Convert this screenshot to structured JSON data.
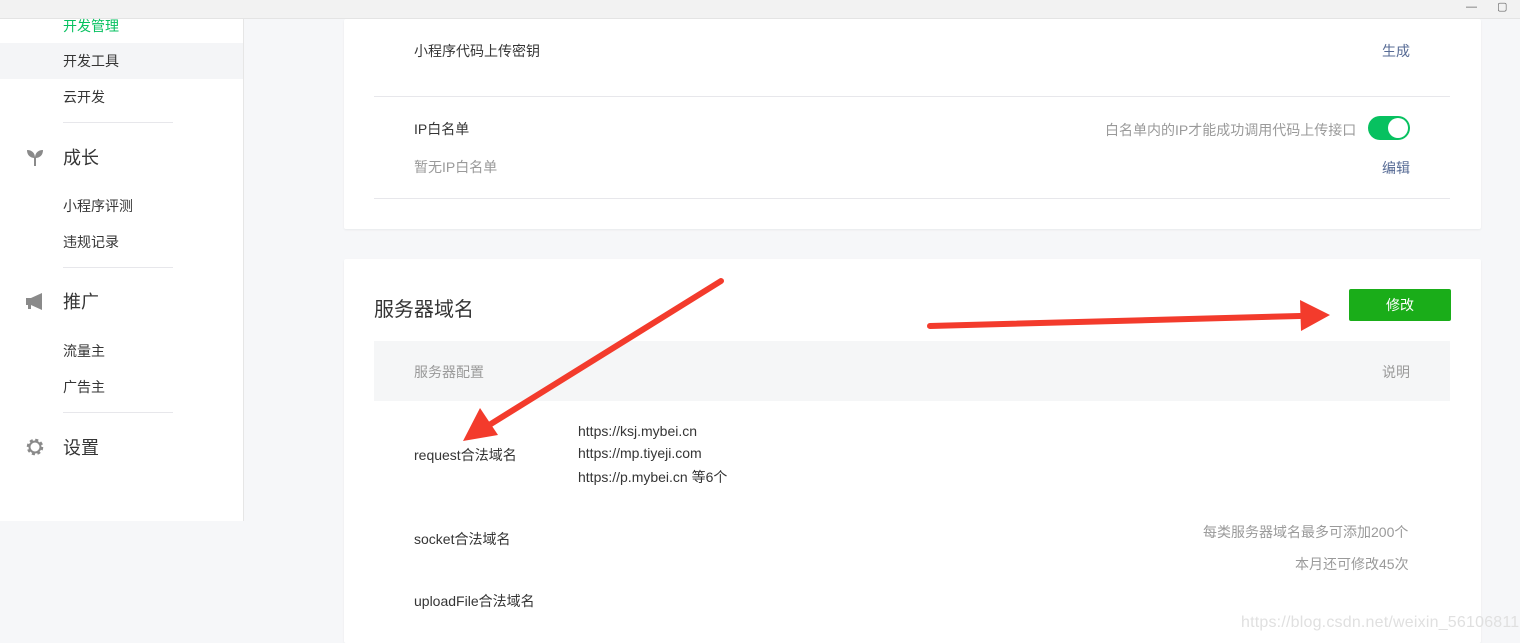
{
  "window": {
    "minimize_glyph": "—",
    "maximize_glyph": "▢"
  },
  "sidebar": {
    "items_top": [
      {
        "label": "开发管理",
        "active": true
      },
      {
        "label": "开发工具",
        "active": false
      },
      {
        "label": "云开发",
        "active": false
      }
    ],
    "groups": [
      {
        "label": "成长",
        "icon": "sprout-icon",
        "items": [
          "小程序评测",
          "违规记录"
        ]
      },
      {
        "label": "推广",
        "icon": "megaphone-icon",
        "items": [
          "流量主",
          "广告主"
        ]
      },
      {
        "label": "设置",
        "icon": "gear-icon",
        "items": []
      }
    ],
    "active_color": "#07c160"
  },
  "dev_settings": {
    "upload_key_label": "小程序代码上传密钥",
    "upload_key_action": "生成",
    "ip_whitelist_label": "IP白名单",
    "ip_whitelist_hint": "白名单内的IP才能成功调用代码上传接口",
    "ip_whitelist_enabled": true,
    "ip_whitelist_empty": "暂无IP白名单",
    "ip_whitelist_action": "编辑"
  },
  "server_domain": {
    "title": "服务器域名",
    "modify_button": "修改",
    "table_headers": {
      "config": "服务器配置",
      "note": "说明"
    },
    "request_label": "request合法域名",
    "request_domains": [
      "https://ksj.mybei.cn",
      "https://mp.tiyeji.com",
      "https://p.mybei.cn 等6个"
    ],
    "socket_label": "socket合法域名",
    "upload_label": "uploadFile合法域名",
    "note_limit": "每类服务器域名最多可添加200个",
    "note_remaining": "本月还可修改45次"
  },
  "watermark": "https://blog.csdn.net/weixin_56106811",
  "colors": {
    "accent_green": "#07c160",
    "button_green": "#1aad19",
    "link": "#576b95",
    "arrow_red": "#f33b2c"
  }
}
